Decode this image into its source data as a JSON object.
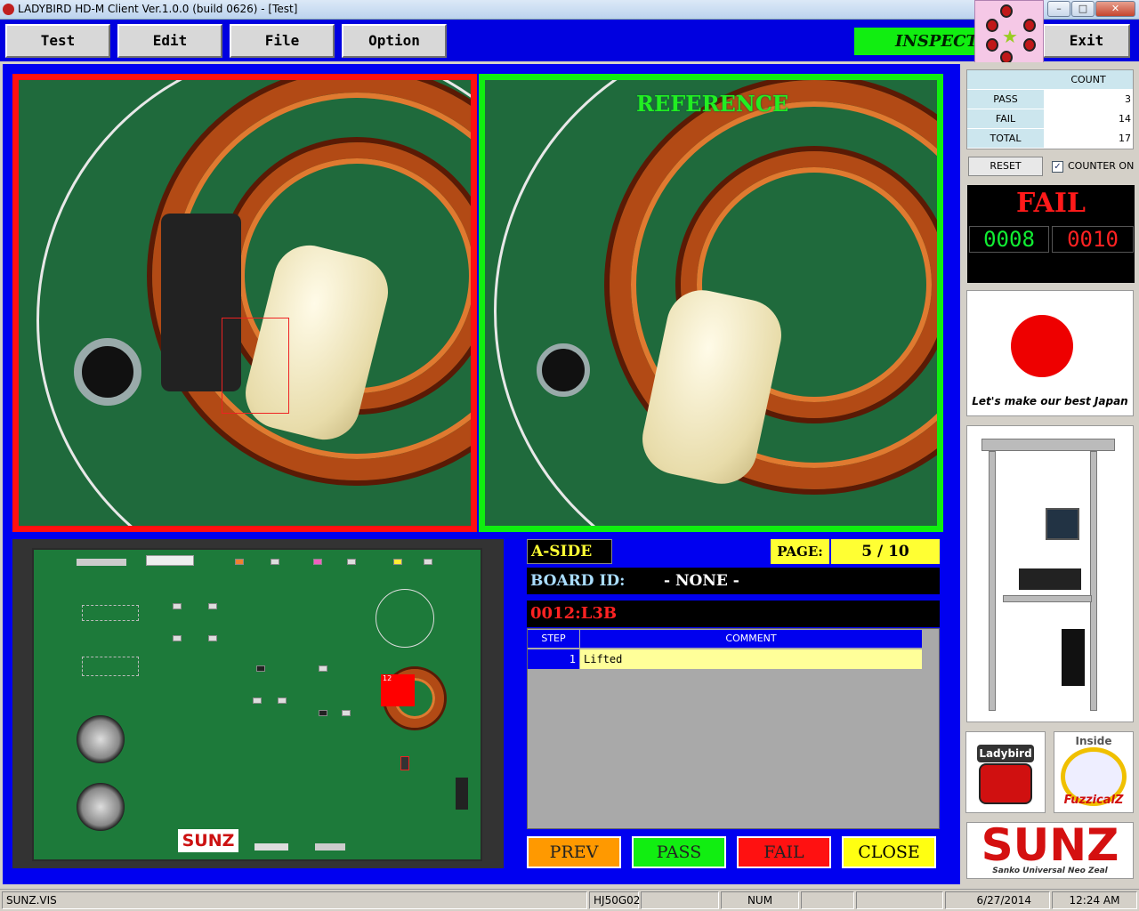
{
  "window": {
    "title": "LADYBIRD HD-M Client Ver.1.0.0  (build 0626) - [Test]",
    "min": "–",
    "max": "□",
    "close": "✕"
  },
  "menu": {
    "test": "Test",
    "edit": "Edit",
    "file": "File",
    "option": "Option",
    "exit": "Exit",
    "status": "INSPECT"
  },
  "images": {
    "reference_label": "REFERENCE"
  },
  "inspection": {
    "side": "A-SIDE",
    "page_label": "PAGE:",
    "page_value": "5 / 10",
    "board_id_label": "BOARD ID:",
    "board_id_value": "- NONE -",
    "part_id": "0012:L3B",
    "table": {
      "headers": [
        "STEP",
        "COMMENT"
      ],
      "rows": [
        {
          "step": "1",
          "comment": "Lifted"
        }
      ]
    }
  },
  "board_image": {
    "logo_text": "SUNZ",
    "marker_number": "12"
  },
  "actions": {
    "prev": "PREV",
    "pass": "PASS",
    "fail": "FAIL",
    "close": "CLOSE",
    "colors": {
      "prev": "#ff9900",
      "pass": "#11ee11",
      "fail": "#ff1111",
      "close": "#ffff11"
    }
  },
  "counter": {
    "header": "COUNT",
    "rows": [
      {
        "label": "PASS",
        "value": "3"
      },
      {
        "label": "FAIL",
        "value": "14"
      },
      {
        "label": "TOTAL",
        "value": "17"
      }
    ],
    "reset": "RESET",
    "counter_on_label": "COUNTER ON",
    "counter_on_checked": true,
    "check_mark": "✓"
  },
  "result": {
    "status": "FAIL",
    "counter_left": "0008",
    "counter_right": "0010"
  },
  "logos": {
    "japan_caption": "Let's make our best Japan",
    "ladybird": "Ladybird",
    "fuzzical_inside": "Inside",
    "fuzzical": "FuzzicalZ",
    "sunz": "SUNZ",
    "sunz_sub": "Sanko Universal Neo Zeal"
  },
  "statusbar": {
    "file": "SUNZ.VIS",
    "model": "HJ50G02",
    "num": "NUM",
    "date": "6/27/2014",
    "time": "12:24 AM"
  }
}
